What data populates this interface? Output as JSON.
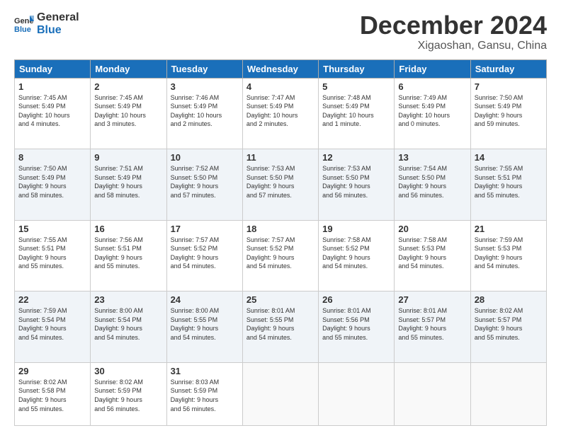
{
  "header": {
    "logo_line1": "General",
    "logo_line2": "Blue",
    "month_title": "December 2024",
    "location": "Xigaoshan, Gansu, China"
  },
  "weekdays": [
    "Sunday",
    "Monday",
    "Tuesday",
    "Wednesday",
    "Thursday",
    "Friday",
    "Saturday"
  ],
  "weeks": [
    [
      {
        "day": "1",
        "info": "Sunrise: 7:45 AM\nSunset: 5:49 PM\nDaylight: 10 hours\nand 4 minutes."
      },
      {
        "day": "2",
        "info": "Sunrise: 7:45 AM\nSunset: 5:49 PM\nDaylight: 10 hours\nand 3 minutes."
      },
      {
        "day": "3",
        "info": "Sunrise: 7:46 AM\nSunset: 5:49 PM\nDaylight: 10 hours\nand 2 minutes."
      },
      {
        "day": "4",
        "info": "Sunrise: 7:47 AM\nSunset: 5:49 PM\nDaylight: 10 hours\nand 2 minutes."
      },
      {
        "day": "5",
        "info": "Sunrise: 7:48 AM\nSunset: 5:49 PM\nDaylight: 10 hours\nand 1 minute."
      },
      {
        "day": "6",
        "info": "Sunrise: 7:49 AM\nSunset: 5:49 PM\nDaylight: 10 hours\nand 0 minutes."
      },
      {
        "day": "7",
        "info": "Sunrise: 7:50 AM\nSunset: 5:49 PM\nDaylight: 9 hours\nand 59 minutes."
      }
    ],
    [
      {
        "day": "8",
        "info": "Sunrise: 7:50 AM\nSunset: 5:49 PM\nDaylight: 9 hours\nand 58 minutes."
      },
      {
        "day": "9",
        "info": "Sunrise: 7:51 AM\nSunset: 5:49 PM\nDaylight: 9 hours\nand 58 minutes."
      },
      {
        "day": "10",
        "info": "Sunrise: 7:52 AM\nSunset: 5:50 PM\nDaylight: 9 hours\nand 57 minutes."
      },
      {
        "day": "11",
        "info": "Sunrise: 7:53 AM\nSunset: 5:50 PM\nDaylight: 9 hours\nand 57 minutes."
      },
      {
        "day": "12",
        "info": "Sunrise: 7:53 AM\nSunset: 5:50 PM\nDaylight: 9 hours\nand 56 minutes."
      },
      {
        "day": "13",
        "info": "Sunrise: 7:54 AM\nSunset: 5:50 PM\nDaylight: 9 hours\nand 56 minutes."
      },
      {
        "day": "14",
        "info": "Sunrise: 7:55 AM\nSunset: 5:51 PM\nDaylight: 9 hours\nand 55 minutes."
      }
    ],
    [
      {
        "day": "15",
        "info": "Sunrise: 7:55 AM\nSunset: 5:51 PM\nDaylight: 9 hours\nand 55 minutes."
      },
      {
        "day": "16",
        "info": "Sunrise: 7:56 AM\nSunset: 5:51 PM\nDaylight: 9 hours\nand 55 minutes."
      },
      {
        "day": "17",
        "info": "Sunrise: 7:57 AM\nSunset: 5:52 PM\nDaylight: 9 hours\nand 54 minutes."
      },
      {
        "day": "18",
        "info": "Sunrise: 7:57 AM\nSunset: 5:52 PM\nDaylight: 9 hours\nand 54 minutes."
      },
      {
        "day": "19",
        "info": "Sunrise: 7:58 AM\nSunset: 5:52 PM\nDaylight: 9 hours\nand 54 minutes."
      },
      {
        "day": "20",
        "info": "Sunrise: 7:58 AM\nSunset: 5:53 PM\nDaylight: 9 hours\nand 54 minutes."
      },
      {
        "day": "21",
        "info": "Sunrise: 7:59 AM\nSunset: 5:53 PM\nDaylight: 9 hours\nand 54 minutes."
      }
    ],
    [
      {
        "day": "22",
        "info": "Sunrise: 7:59 AM\nSunset: 5:54 PM\nDaylight: 9 hours\nand 54 minutes."
      },
      {
        "day": "23",
        "info": "Sunrise: 8:00 AM\nSunset: 5:54 PM\nDaylight: 9 hours\nand 54 minutes."
      },
      {
        "day": "24",
        "info": "Sunrise: 8:00 AM\nSunset: 5:55 PM\nDaylight: 9 hours\nand 54 minutes."
      },
      {
        "day": "25",
        "info": "Sunrise: 8:01 AM\nSunset: 5:55 PM\nDaylight: 9 hours\nand 54 minutes."
      },
      {
        "day": "26",
        "info": "Sunrise: 8:01 AM\nSunset: 5:56 PM\nDaylight: 9 hours\nand 55 minutes."
      },
      {
        "day": "27",
        "info": "Sunrise: 8:01 AM\nSunset: 5:57 PM\nDaylight: 9 hours\nand 55 minutes."
      },
      {
        "day": "28",
        "info": "Sunrise: 8:02 AM\nSunset: 5:57 PM\nDaylight: 9 hours\nand 55 minutes."
      }
    ],
    [
      {
        "day": "29",
        "info": "Sunrise: 8:02 AM\nSunset: 5:58 PM\nDaylight: 9 hours\nand 55 minutes."
      },
      {
        "day": "30",
        "info": "Sunrise: 8:02 AM\nSunset: 5:59 PM\nDaylight: 9 hours\nand 56 minutes."
      },
      {
        "day": "31",
        "info": "Sunrise: 8:03 AM\nSunset: 5:59 PM\nDaylight: 9 hours\nand 56 minutes."
      },
      null,
      null,
      null,
      null
    ]
  ]
}
